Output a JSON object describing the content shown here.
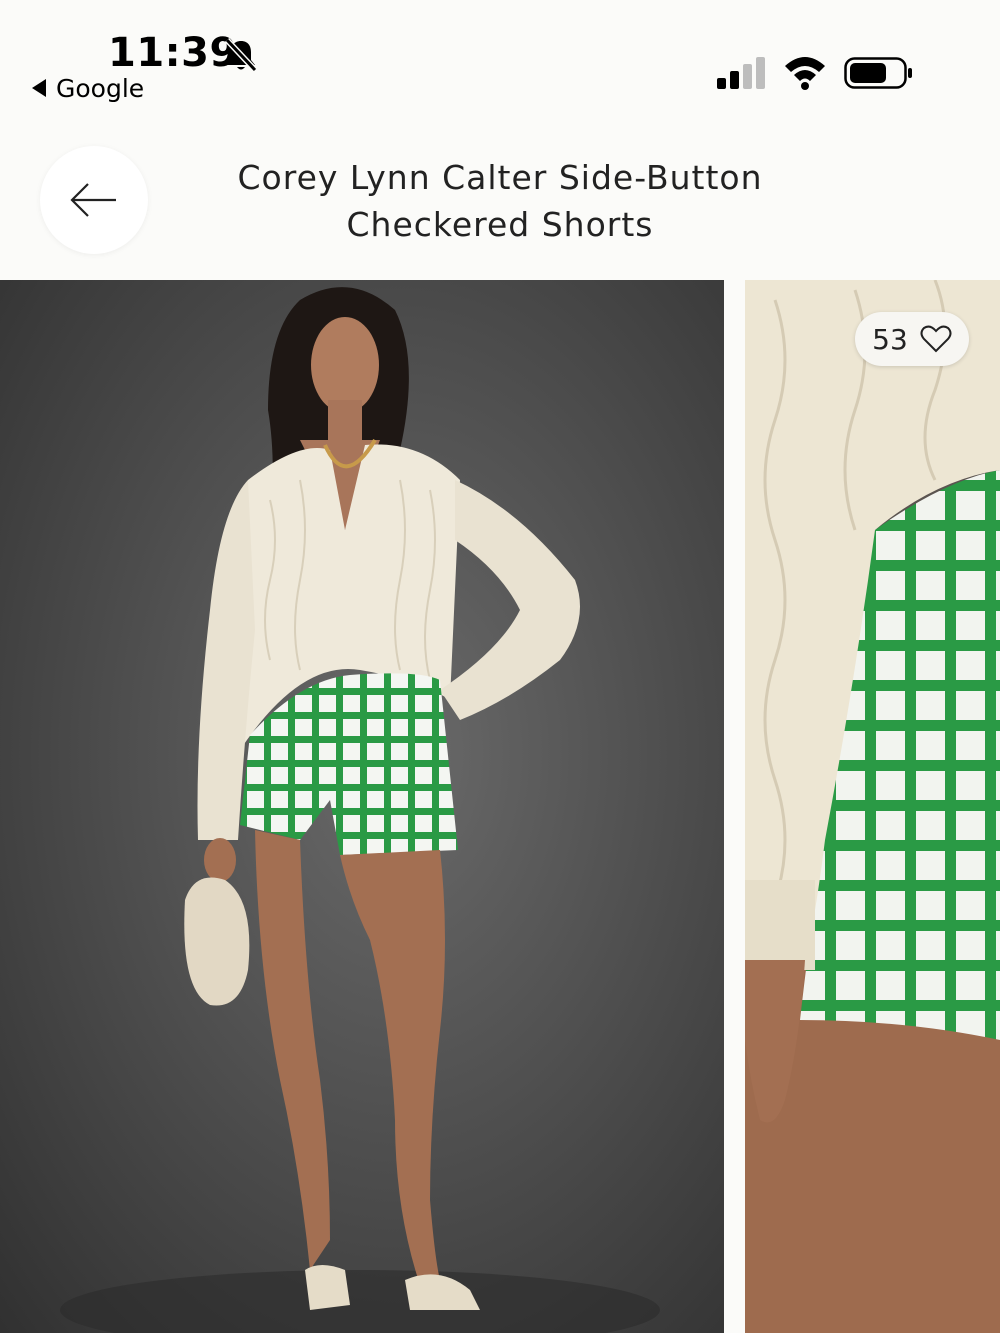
{
  "status_bar": {
    "time": "11:39",
    "back_app": "Google",
    "icons": [
      "bell-slash-icon",
      "cellular-signal-icon",
      "wifi-icon",
      "battery-icon"
    ]
  },
  "header": {
    "back_icon": "arrow-left-icon",
    "title_line1": "Corey Lynn Calter Side-Button",
    "title_line2": "Checkered Shorts"
  },
  "gallery": {
    "like_count": "53",
    "like_icon": "heart-outline-icon"
  },
  "colors": {
    "background": "#fbfbf9",
    "studio_backdrop": "#4a4a4a",
    "shorts_green": "#2a9a45",
    "cardigan_cream": "#efe9da"
  }
}
